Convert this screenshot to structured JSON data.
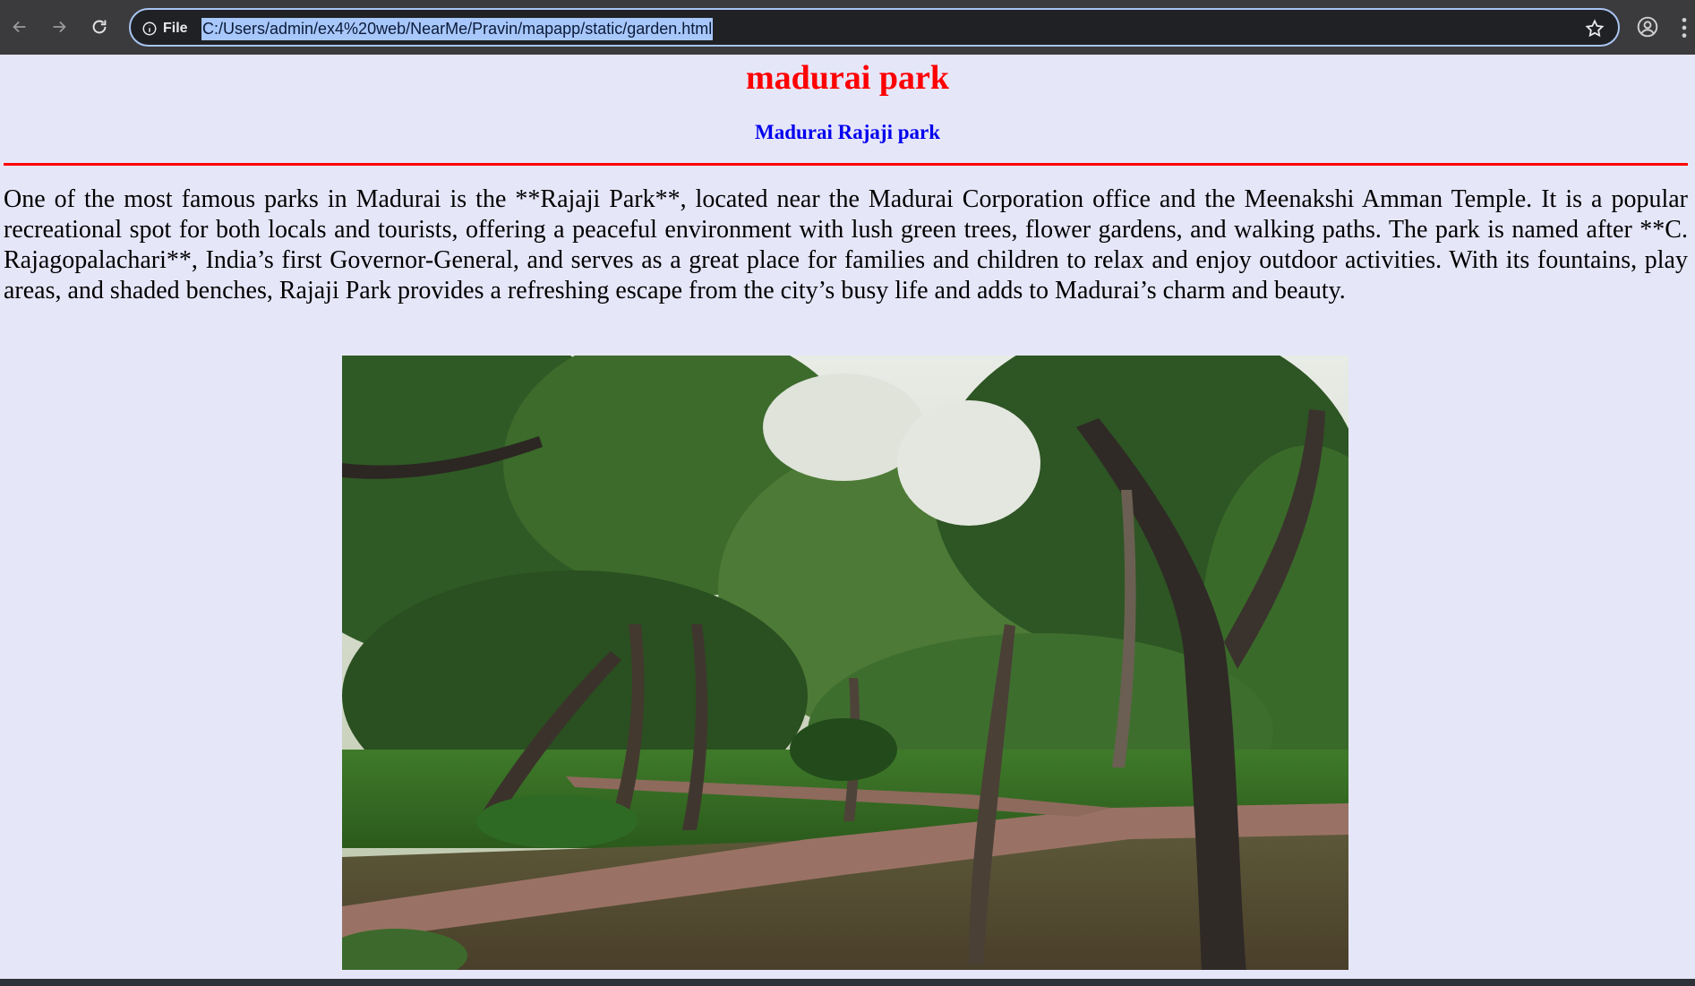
{
  "browser": {
    "site_info_label": "File",
    "url": "C:/Users/admin/ex4%20web/NearMe/Pravin/mapapp/static/garden.html"
  },
  "page": {
    "title": "madurai park",
    "subtitle": "Madurai Rajaji park",
    "description": "One of the most famous parks in Madurai is the **Rajaji Park**, located near the Madurai Corporation office and the Meenakshi Amman Temple. It is a popular recreational spot for both locals and tourists, offering a peaceful environment with lush green trees, flower gardens, and walking paths. The park is named after **C. Rajagopalachari**, India’s first Governor-General, and serves as a great place for families and children to relax and enjoy outdoor activities. With its fountains, play areas, and shaded benches, Rajaji Park provides a refreshing escape from the city’s busy life and adds to Madurai’s charm and beauty.",
    "image_subject": "park-trees-photo"
  },
  "colors": {
    "page_background": "#e6e6f9",
    "title": "#ff0000",
    "subtitle": "#0000ee",
    "divider": "#ff0000"
  }
}
